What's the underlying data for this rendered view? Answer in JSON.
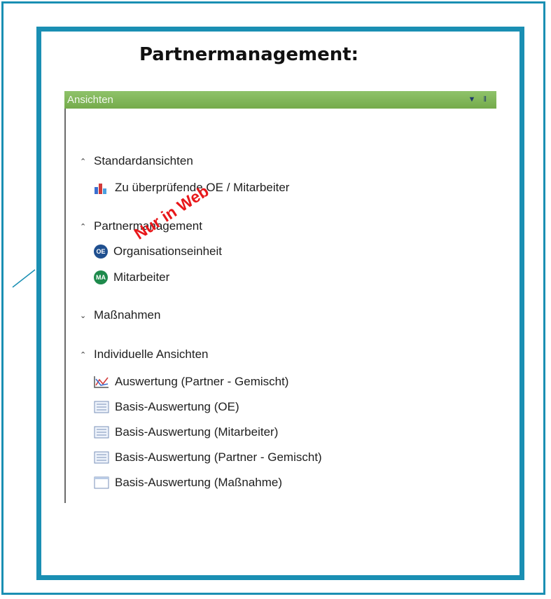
{
  "slide": {
    "title": "Partnermanagement:"
  },
  "panel": {
    "header": "Ansichten",
    "header_icons": [
      "dropdown-arrow-icon",
      "pin-icon"
    ],
    "sections": [
      {
        "label": "Standardansichten",
        "expanded": true,
        "items": [
          {
            "label": "Zu überprüfende OE / Mitarbeiter",
            "icon": "bar-chart-icon"
          }
        ]
      },
      {
        "label": "Partnermanagement",
        "expanded": true,
        "items": [
          {
            "label": "Organisationseinheit",
            "icon": "oe-badge-icon",
            "badge": "OE"
          },
          {
            "label": "Mitarbeiter",
            "icon": "ma-badge-icon",
            "badge": "MA"
          }
        ]
      },
      {
        "label": "Maßnahmen",
        "expanded": false,
        "items": []
      },
      {
        "label": "Individuelle Ansichten",
        "expanded": true,
        "items": [
          {
            "label": "Auswertung (Partner - Gemischt)",
            "icon": "chart-line-icon"
          },
          {
            "label": "Basis-Auswertung (OE)",
            "icon": "table-icon"
          },
          {
            "label": "Basis-Auswertung (Mitarbeiter)",
            "icon": "table-icon"
          },
          {
            "label": "Basis-Auswertung (Partner - Gemischt)",
            "icon": "table-icon"
          },
          {
            "label": "Basis-Auswertung (Maßnahme)",
            "icon": "window-icon"
          }
        ]
      }
    ]
  },
  "watermark": "Nur in Web",
  "colors": {
    "frame": "#1a8fb3",
    "header": "#7ab552",
    "watermark": "#e8171a",
    "oe_badge": "#1f4f8f",
    "ma_badge": "#1e8a4c"
  }
}
